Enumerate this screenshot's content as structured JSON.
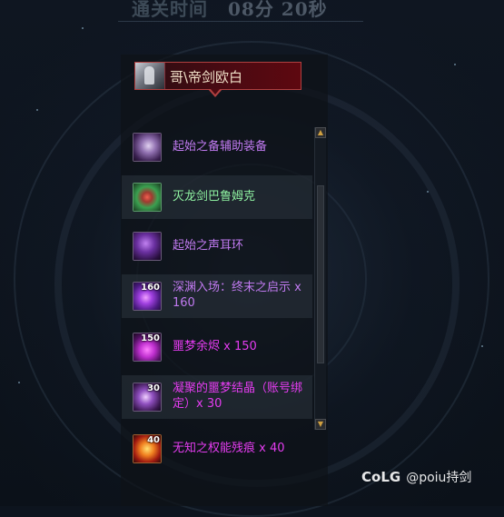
{
  "timer": {
    "label": "通关时间",
    "value": "08分 20秒"
  },
  "character": {
    "name": "哥\\帝剑欧白"
  },
  "items": [
    {
      "name": "起始之备辅助装备",
      "count": "",
      "color": "purple"
    },
    {
      "name": "灭龙剑巴鲁姆克",
      "count": "",
      "color": "green"
    },
    {
      "name": "起始之声耳环",
      "count": "",
      "color": "purple"
    },
    {
      "name": "深渊入场：终末之启示 x 160",
      "count": "160",
      "color": "purple"
    },
    {
      "name": "噩梦余烬 x 150",
      "count": "150",
      "color": "magenta"
    },
    {
      "name": "凝聚的噩梦结晶（账号绑定）x 30",
      "count": "30",
      "color": "magenta"
    },
    {
      "name": "无知之权能残痕 x 40",
      "count": "40",
      "color": "magenta"
    }
  ],
  "scrollbar": {
    "up_arrow": "▲",
    "down_arrow": "▼"
  },
  "watermark": {
    "logo": "CoLG",
    "user": "@poiu持剑"
  },
  "colors": {
    "purple": "#c07af0",
    "magenta": "#e43cf0",
    "green": "#8ef0a0",
    "tag_border": "#b04040"
  }
}
